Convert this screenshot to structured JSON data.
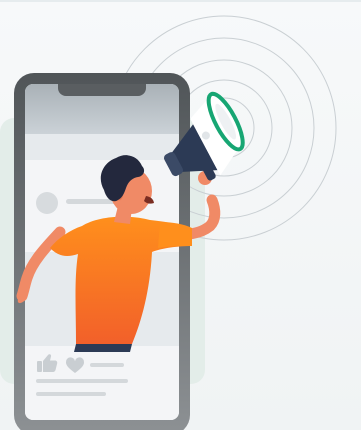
{
  "illustration": {
    "icons": [
      "thumbs-up-icon",
      "heart-icon",
      "megaphone-icon"
    ],
    "colors": {
      "phone_frame": "#5f6366",
      "screen_header": "#b9c1c7",
      "screen_body": "#e6eaed",
      "post_card": "#f4f5f7",
      "placeholder_gray": "#d4d8db",
      "shirt_orange": "#ff8a1d",
      "shirt_orange_dark": "#f26a1e",
      "skin": "#f08a66",
      "hair": "#23283d",
      "megaphone_green": "#17a673",
      "megaphone_navy": "#2c3a55",
      "backdrop_mint": "#e3ede9",
      "sound_rings": "#c9cfd3"
    }
  }
}
